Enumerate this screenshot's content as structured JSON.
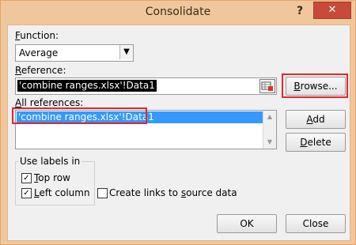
{
  "window": {
    "title": "Consolidate",
    "help": "?",
    "close": "✕"
  },
  "function": {
    "label_first": "F",
    "label_rest": "unction:",
    "value": "Average",
    "arrow": "▼"
  },
  "reference": {
    "label_first": "R",
    "label_rest": "eference:",
    "value": "'combine ranges.xlsx'!Data1",
    "browse_first": "B",
    "browse_rest": "rowse..."
  },
  "all_references": {
    "label_first": "A",
    "label_rest": "ll references:",
    "items": [
      "'combine ranges.xlsx'!Data1"
    ],
    "add_first": "A",
    "add_rest": "dd",
    "delete_first": "D",
    "delete_rest": "elete"
  },
  "labels": {
    "group_title": "Use labels in",
    "top_row_first": "T",
    "top_row_rest": "op row",
    "top_row_checked": true,
    "left_column_first": "L",
    "left_column_rest": "eft column",
    "left_column_checked": true,
    "links_pre": "Create links to ",
    "links_u": "s",
    "links_post": "ource data",
    "links_checked": false
  },
  "buttons": {
    "ok": "OK",
    "close": "Close"
  },
  "glyphs": {
    "check": "✓"
  }
}
